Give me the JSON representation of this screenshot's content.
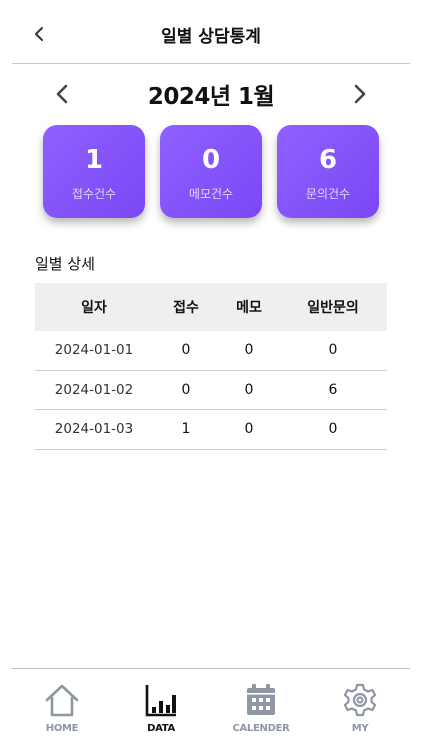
{
  "header": {
    "title": "일별 상담통계"
  },
  "month_nav": {
    "label": "2024년 1월"
  },
  "summary": [
    {
      "value": "1",
      "label": "접수건수"
    },
    {
      "value": "0",
      "label": "메모건수"
    },
    {
      "value": "6",
      "label": "문의건수"
    }
  ],
  "detail": {
    "title": "일별 상세",
    "columns": [
      "일자",
      "접수",
      "메모",
      "일반문의"
    ],
    "rows": [
      [
        "2024-01-01",
        "0",
        "0",
        "0"
      ],
      [
        "2024-01-02",
        "0",
        "0",
        "6"
      ],
      [
        "2024-01-03",
        "1",
        "0",
        "0"
      ]
    ]
  },
  "tabs": [
    {
      "label": "HOME",
      "icon": "home-icon",
      "active": false
    },
    {
      "label": "DATA",
      "icon": "bar-chart-icon",
      "active": true
    },
    {
      "label": "CALENDER",
      "icon": "calendar-icon",
      "active": false
    },
    {
      "label": "MY",
      "icon": "gear-icon",
      "active": false
    }
  ],
  "colors": {
    "card_gradient_start": "#8f61ff",
    "card_gradient_end": "#7b47f5",
    "tab_inactive": "#8e97a3",
    "tab_active": "#111111"
  }
}
